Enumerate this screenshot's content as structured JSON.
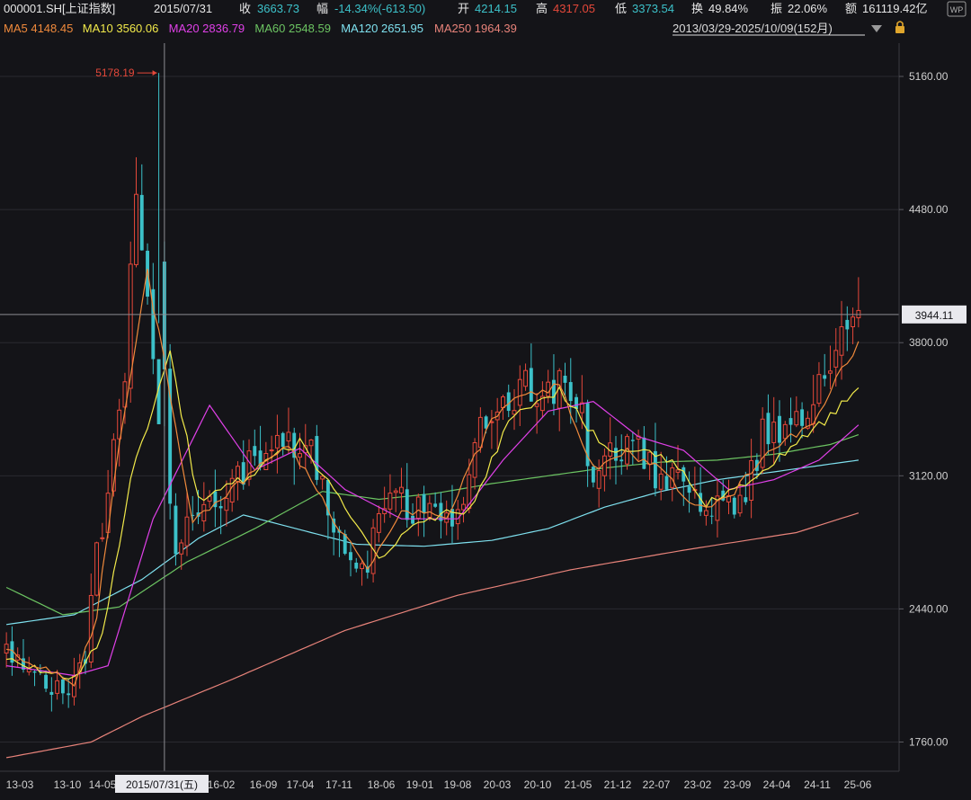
{
  "header": {
    "code": "000001.SH[上证指数]",
    "date": "2015/07/31",
    "close_label": "收",
    "close_value": "3663.73",
    "change_label": "幅",
    "change_value": "-14.34%(-613.50)",
    "open_label": "开",
    "open_value": "4214.15",
    "high_label": "高",
    "high_value": "4317.05",
    "low_label": "低",
    "low_value": "3373.54",
    "turnover_label": "换",
    "turnover_value": "49.84%",
    "amplitude_label": "振",
    "amplitude_value": "22.06%",
    "amount_label": "额",
    "amount_value": "161119.42亿",
    "wp_badge": "WP",
    "range_label": "2013/03/29-2025/10/09(152月)",
    "range_dropdown_icon": "triangle-down-icon",
    "lock_icon": "lock-icon"
  },
  "ma_legend": [
    {
      "label": "MA5",
      "value": "4148.45",
      "color": "#f08a3c"
    },
    {
      "label": "MA10",
      "value": "3560.06",
      "color": "#f1e94a"
    },
    {
      "label": "MA20",
      "value": "2836.79",
      "color": "#e040e8"
    },
    {
      "label": "MA60",
      "value": "2548.59",
      "color": "#6cc462"
    },
    {
      "label": "MA120",
      "value": "2651.95",
      "color": "#7ee0ee"
    },
    {
      "label": "MA250",
      "value": "1964.39",
      "color": "#e8837a"
    }
  ],
  "colors": {
    "up": "#e5483a",
    "down": "#3cc1c9",
    "background": "#141418",
    "grid": "#2a2a30"
  },
  "chart_data": {
    "type": "candlestick",
    "period": "monthly",
    "range": "2013/03 - 2025/10",
    "ylim": [
      1620,
      5330
    ],
    "y_ticks": [
      "5160.00",
      "4480.00",
      "3800.00",
      "3120.00",
      "2440.00",
      "1760.00"
    ],
    "x_ticks": [
      "13-03",
      "13-10",
      "14-05",
      "2015/07/31(五)",
      "16-02",
      "16-09",
      "17-04",
      "17-11",
      "18-06",
      "19-01",
      "19-08",
      "20-03",
      "20-10",
      "21-05",
      "21-12",
      "22-07",
      "23-02",
      "23-09",
      "24-04",
      "24-11",
      "25-06"
    ],
    "selected_x": "2015/07/31(五)",
    "crosshair_price": "3944.11",
    "max_annotation": "5178.19",
    "anchors": [
      [
        0,
        2210
      ],
      [
        3,
        2120
      ],
      [
        6,
        2060
      ],
      [
        9,
        2040
      ],
      [
        12,
        2040
      ],
      [
        14,
        2200
      ],
      [
        16,
        2700
      ],
      [
        19,
        3250
      ],
      [
        21,
        3700
      ],
      [
        23,
        4550
      ],
      [
        26,
        3663
      ],
      [
        28,
        3200
      ],
      [
        30,
        2800
      ],
      [
        34,
        2950
      ],
      [
        38,
        3000
      ],
      [
        44,
        3200
      ],
      [
        50,
        3260
      ],
      [
        54,
        3300
      ],
      [
        58,
        2800
      ],
      [
        62,
        2600
      ],
      [
        64,
        2700
      ],
      [
        68,
        3050
      ],
      [
        72,
        2920
      ],
      [
        76,
        2980
      ],
      [
        80,
        2900
      ],
      [
        84,
        3350
      ],
      [
        88,
        3550
      ],
      [
        94,
        3560
      ],
      [
        98,
        3600
      ],
      [
        102,
        3400
      ],
      [
        104,
        3050
      ],
      [
        108,
        3260
      ],
      [
        112,
        3300
      ],
      [
        116,
        3100
      ],
      [
        120,
        3100
      ],
      [
        124,
        2950
      ],
      [
        128,
        3010
      ],
      [
        130,
        2960
      ],
      [
        134,
        3320
      ],
      [
        138,
        3380
      ],
      [
        142,
        3400
      ],
      [
        146,
        3700
      ],
      [
        149,
        3880
      ],
      [
        151,
        3944
      ]
    ],
    "ma_anchors": {
      "MA5": [
        [
          0,
          2230
        ],
        [
          12,
          2060
        ],
        [
          16,
          2400
        ],
        [
          20,
          3300
        ],
        [
          25,
          4150
        ],
        [
          28,
          3700
        ],
        [
          33,
          2900
        ],
        [
          40,
          3050
        ],
        [
          50,
          3280
        ],
        [
          58,
          2900
        ],
        [
          64,
          2650
        ],
        [
          70,
          2950
        ],
        [
          78,
          2900
        ],
        [
          86,
          3400
        ],
        [
          92,
          3550
        ],
        [
          98,
          3580
        ],
        [
          104,
          3150
        ],
        [
          110,
          3250
        ],
        [
          116,
          3150
        ],
        [
          122,
          2950
        ],
        [
          128,
          3000
        ],
        [
          136,
          3280
        ],
        [
          142,
          3350
        ],
        [
          151,
          3800
        ]
      ],
      "MA10": [
        [
          0,
          2180
        ],
        [
          12,
          2080
        ],
        [
          17,
          2300
        ],
        [
          22,
          3100
        ],
        [
          29,
          3750
        ],
        [
          34,
          3000
        ],
        [
          42,
          3100
        ],
        [
          52,
          3300
        ],
        [
          60,
          2950
        ],
        [
          66,
          2700
        ],
        [
          74,
          2900
        ],
        [
          82,
          2950
        ],
        [
          90,
          3450
        ],
        [
          98,
          3560
        ],
        [
          106,
          3250
        ],
        [
          112,
          3250
        ],
        [
          118,
          3200
        ],
        [
          124,
          2980
        ],
        [
          132,
          3100
        ],
        [
          140,
          3280
        ],
        [
          151,
          3550
        ]
      ],
      "MA20": [
        [
          0,
          2150
        ],
        [
          12,
          2100
        ],
        [
          18,
          2150
        ],
        [
          26,
          2900
        ],
        [
          36,
          3480
        ],
        [
          44,
          3150
        ],
        [
          52,
          3260
        ],
        [
          60,
          3050
        ],
        [
          70,
          2900
        ],
        [
          80,
          2900
        ],
        [
          88,
          3200
        ],
        [
          96,
          3450
        ],
        [
          104,
          3500
        ],
        [
          112,
          3320
        ],
        [
          120,
          3250
        ],
        [
          128,
          3050
        ],
        [
          136,
          3100
        ],
        [
          144,
          3200
        ],
        [
          151,
          3380
        ]
      ],
      "MA60": [
        [
          0,
          2550
        ],
        [
          10,
          2410
        ],
        [
          20,
          2450
        ],
        [
          32,
          2680
        ],
        [
          44,
          2850
        ],
        [
          56,
          3040
        ],
        [
          66,
          3000
        ],
        [
          76,
          3030
        ],
        [
          86,
          3080
        ],
        [
          96,
          3120
        ],
        [
          106,
          3160
        ],
        [
          116,
          3190
        ],
        [
          126,
          3200
        ],
        [
          136,
          3230
        ],
        [
          146,
          3280
        ],
        [
          151,
          3330
        ]
      ],
      "MA120": [
        [
          0,
          2360
        ],
        [
          12,
          2410
        ],
        [
          24,
          2590
        ],
        [
          34,
          2800
        ],
        [
          42,
          2920
        ],
        [
          50,
          2860
        ],
        [
          62,
          2770
        ],
        [
          74,
          2760
        ],
        [
          86,
          2790
        ],
        [
          96,
          2850
        ],
        [
          106,
          2960
        ],
        [
          116,
          3040
        ],
        [
          126,
          3100
        ],
        [
          136,
          3140
        ],
        [
          146,
          3180
        ],
        [
          151,
          3200
        ]
      ],
      "MA250": [
        [
          0,
          1680
        ],
        [
          15,
          1760
        ],
        [
          24,
          1890
        ],
        [
          40,
          2080
        ],
        [
          60,
          2330
        ],
        [
          80,
          2510
        ],
        [
          100,
          2640
        ],
        [
          120,
          2740
        ],
        [
          140,
          2830
        ],
        [
          151,
          2930
        ]
      ]
    }
  }
}
